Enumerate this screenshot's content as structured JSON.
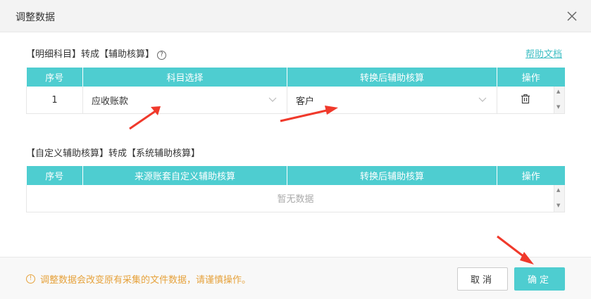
{
  "dialog": {
    "title": "调整数据"
  },
  "section1": {
    "label": "【明细科目】转成【辅助核算】",
    "help_icon": "?",
    "help_link": "帮助文档",
    "columns": [
      "序号",
      "科目选择",
      "转换后辅助核算",
      "操作"
    ],
    "rows": [
      {
        "index": "1",
        "subject": "应收账款",
        "aux": "客户"
      }
    ]
  },
  "section2": {
    "label": "【自定义辅助核算】转成【系统辅助核算】",
    "columns": [
      "序号",
      "来源账套自定义辅助核算",
      "转换后辅助核算",
      "操作"
    ],
    "empty_text": "暂无数据"
  },
  "footer": {
    "warn_icon": "!",
    "warning": "调整数据会改变原有采集的文件数据，请谨慎操作。",
    "cancel_label": "取消",
    "ok_label": "确定"
  },
  "colors": {
    "accent": "#4ecdd0",
    "warning": "#e6a23c",
    "arrow": "#f0392b"
  }
}
